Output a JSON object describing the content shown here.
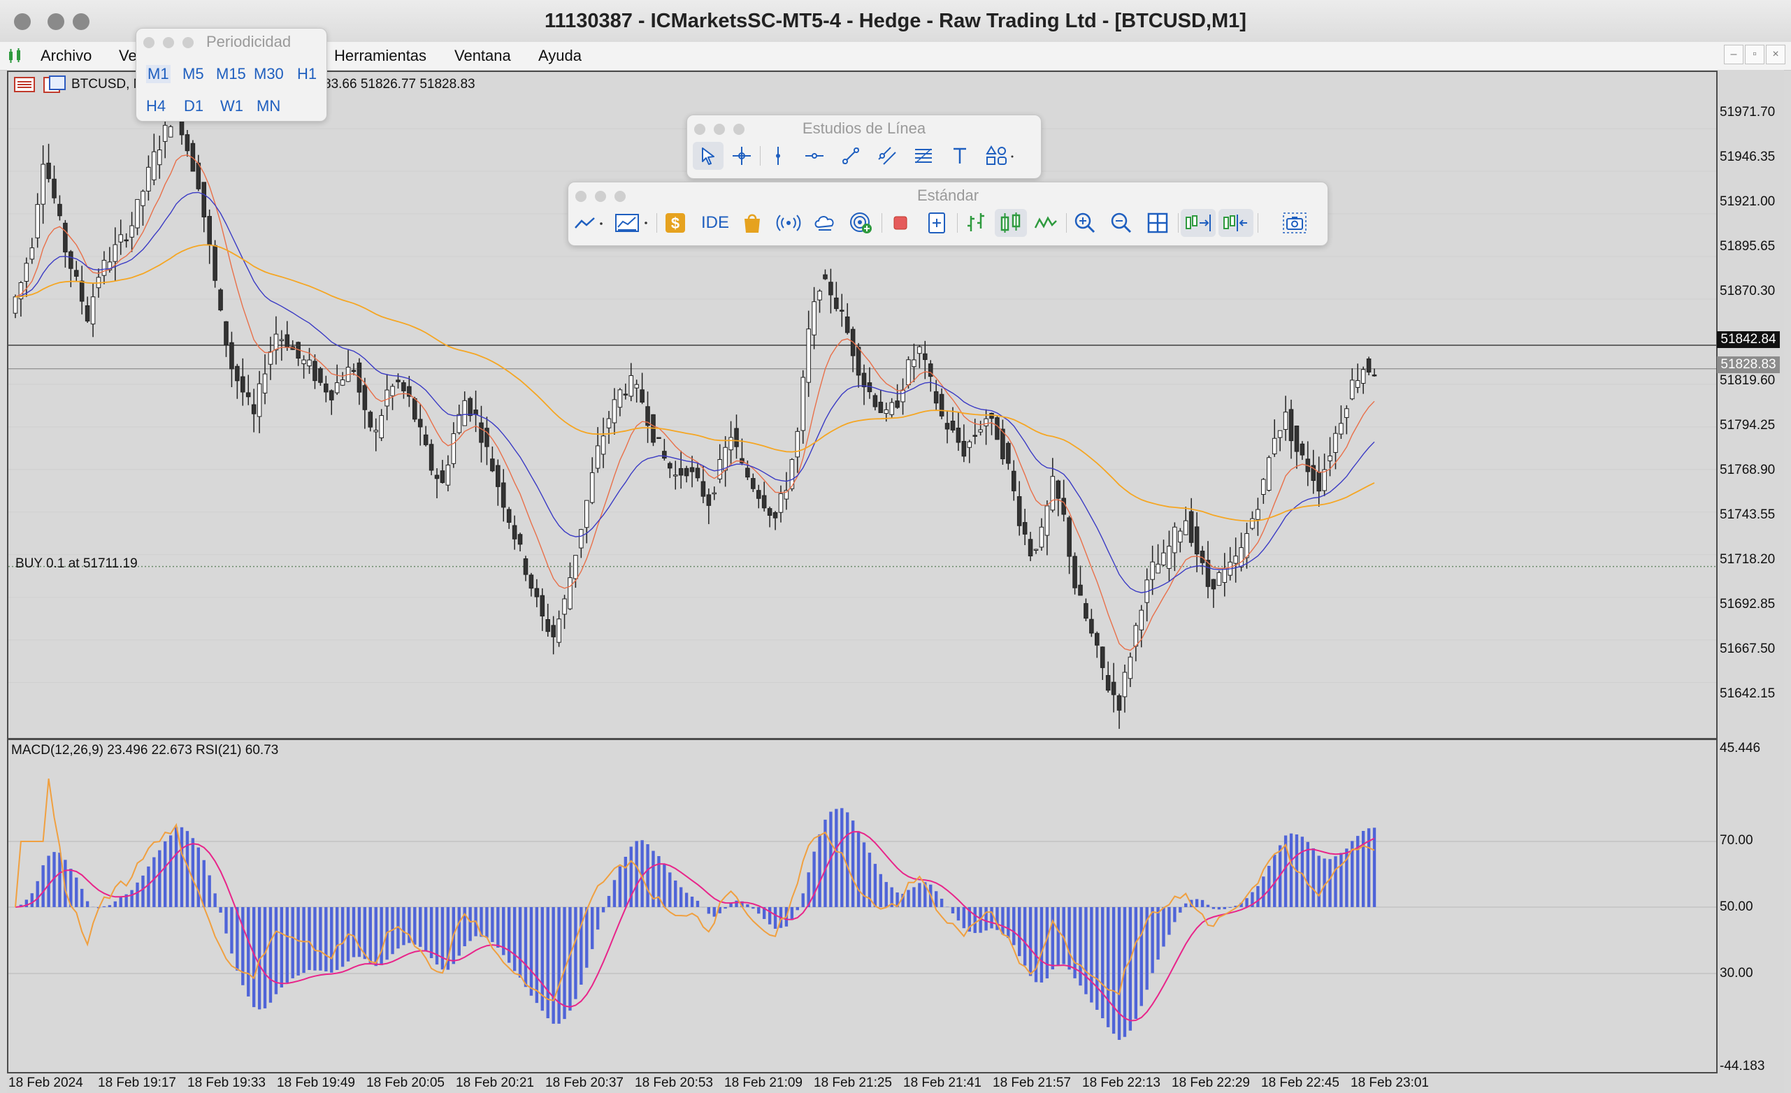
{
  "window": {
    "title": "11130387 - ICMarketsSC-MT5-4 - Hedge - Raw Trading Ltd - [BTCUSD,M1]"
  },
  "menu": {
    "items": [
      "Archivo",
      "Ve",
      "Herramientas",
      "Ventana",
      "Ayuda"
    ]
  },
  "periodicity": {
    "title": "Periodicidad",
    "row1": [
      "M1",
      "M5",
      "M15",
      "M30",
      "H1"
    ],
    "row2": [
      "H4",
      "D1",
      "W1",
      "MN"
    ]
  },
  "line_studies_toolbar": {
    "title": "Estudios de Línea",
    "tools": [
      "cursor-icon",
      "crosshair-icon",
      "vertical-line-icon",
      "horizontal-line-icon",
      "trendline-icon",
      "channel-icon",
      "fibonacci-icon",
      "text-icon",
      "shapes-icon"
    ]
  },
  "standard_toolbar": {
    "title": "Estándar",
    "ide_label": "IDE",
    "tools": [
      "chart-type-icon",
      "indicators-icon",
      "dollar-icon",
      "ide-button",
      "market-bag-icon",
      "signals-icon",
      "vps-cloud-icon",
      "radar-icon",
      "stop-icon",
      "new-order-icon",
      "bar-chart-icon",
      "candle-chart-icon",
      "line-chart-icon",
      "zoom-in-icon",
      "zoom-out-icon",
      "tile-windows-icon",
      "autoscroll-icon",
      "chart-shift-icon",
      "screenshot-icon"
    ]
  },
  "chart": {
    "symbol_label": "BTCUSD, M",
    "ohlc_text": "83.66 51826.77 51828.83",
    "buy_line_label": "BUY 0.1 at 51711.19",
    "indicator_label": "MACD(12,26,9) 23.496 22.673 RSI(21) 60.73",
    "bid_tag": "51842.84",
    "ask_tag": "51828.83",
    "colors": {
      "background": "#d8d8d8",
      "bull_candle": "#ffffff",
      "bear_candle": "#333333",
      "ma_fast": "#e8704a",
      "ma_mid": "#3b3bc4",
      "ma_slow": "#f5a623",
      "macd_hist": "#4f64d8",
      "macd_signal": "#e8258a",
      "rsi": "#f0a040"
    }
  },
  "chart_data": {
    "type": "candlestick",
    "price_axis": {
      "ticks": [
        "51971.70",
        "51946.35",
        "51921.00",
        "51895.65",
        "51870.30",
        "51819.60",
        "51794.25",
        "51768.90",
        "51743.55",
        "51718.20",
        "51692.85",
        "51667.50",
        "51642.15"
      ],
      "range": [
        51610,
        52005
      ]
    },
    "oscillator_axis": {
      "ticks": [
        "45.446",
        "70.00",
        "50.00",
        "30.00",
        "-44.183"
      ]
    },
    "time_axis": {
      "ticks": [
        "18 Feb 2024",
        "18 Feb 19:17",
        "18 Feb 19:33",
        "18 Feb 19:49",
        "18 Feb 20:05",
        "18 Feb 20:21",
        "18 Feb 20:37",
        "18 Feb 20:53",
        "18 Feb 21:09",
        "18 Feb 21:25",
        "18 Feb 21:41",
        "18 Feb 21:57",
        "18 Feb 22:13",
        "18 Feb 22:29",
        "18 Feb 22:45",
        "18 Feb 23:01"
      ]
    },
    "close_series": [
      51862,
      51880,
      51905,
      51955,
      51930,
      51900,
      51880,
      51860,
      51885,
      51895,
      51905,
      51915,
      51935,
      51955,
      51970,
      51985,
      51960,
      51940,
      51900,
      51860,
      51830,
      51815,
      51800,
      51830,
      51850,
      51845,
      51835,
      51830,
      51820,
      51815,
      51825,
      51830,
      51800,
      51790,
      51815,
      51820,
      51810,
      51790,
      51770,
      51760,
      51790,
      51810,
      51800,
      51780,
      51760,
      51740,
      51720,
      51700,
      51680,
      51670,
      51690,
      51720,
      51750,
      51780,
      51800,
      51815,
      51820,
      51810,
      51790,
      51775,
      51765,
      51770,
      51760,
      51750,
      51770,
      51790,
      51770,
      51760,
      51750,
      51740,
      51760,
      51790,
      51850,
      51880,
      51875,
      51860,
      51840,
      51820,
      51810,
      51800,
      51810,
      51830,
      51840,
      51820,
      51800,
      51790,
      51780,
      51790,
      51800,
      51790,
      51770,
      51740,
      51720,
      51730,
      51760,
      51740,
      51700,
      51680,
      51660,
      51640,
      51630,
      51660,
      51690,
      51710,
      51715,
      51730,
      51740,
      51720,
      51700,
      51705,
      51710,
      51720,
      51740,
      51760,
      51790,
      51800,
      51780,
      51770,
      51760,
      51780,
      51800,
      51820,
      51830,
      51828
    ],
    "buy_level": 51711.19,
    "bid": 51842.84,
    "ask": 51828.83
  }
}
